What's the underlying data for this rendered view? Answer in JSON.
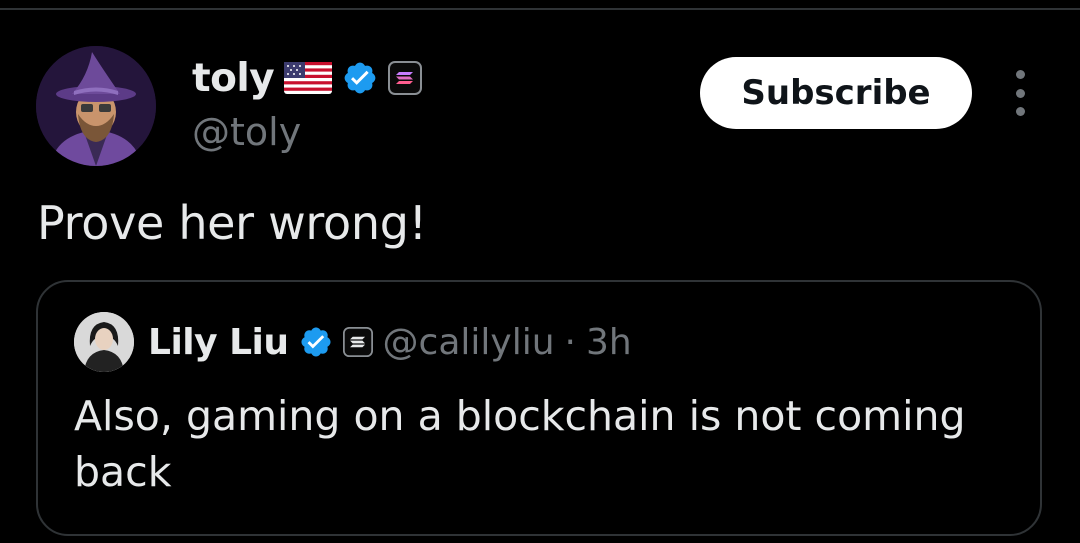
{
  "tweet": {
    "author": {
      "name": "toly",
      "handle": "@toly",
      "flag_icon": "us-flag-icon",
      "verified_icon": "verified-badge-icon",
      "affiliate_icon": "solana-affiliate-icon"
    },
    "subscribe_label": "Subscribe",
    "more_icon": "more-vertical-icon",
    "text": "Prove her wrong!"
  },
  "quote": {
    "author": {
      "name": "Lily Liu",
      "handle": "@calilyliu",
      "verified_icon": "verified-badge-icon",
      "affiliate_icon": "solana-affiliate-icon"
    },
    "separator": "·",
    "time": "3h",
    "text": "Also, gaming on a blockchain is not coming back"
  },
  "colors": {
    "background": "#000000",
    "primary_text": "#e7e9ea",
    "secondary_text": "#71767b",
    "border": "#2f3336",
    "verified_blue": "#1d9bf0",
    "button_bg": "#ffffff"
  }
}
